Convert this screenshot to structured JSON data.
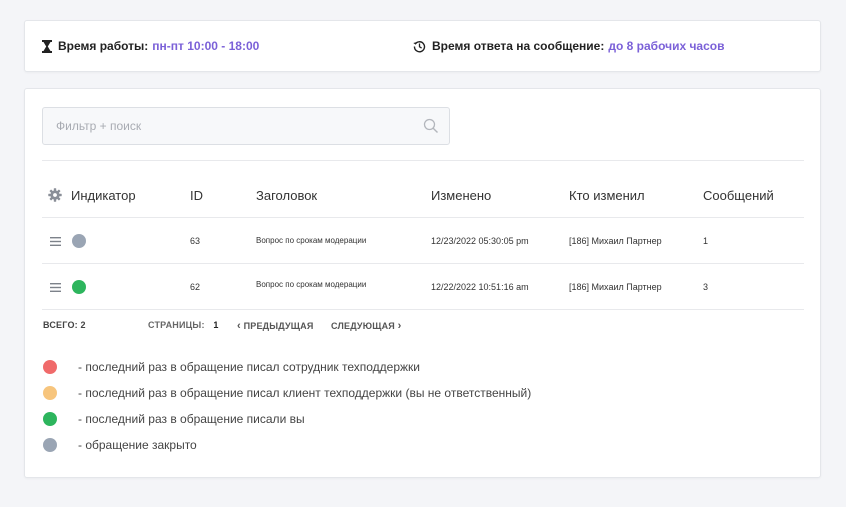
{
  "info": {
    "work_time_label": "Время работы:",
    "work_time_value": "пн-пт 10:00 - 18:00",
    "response_label": "Время ответа на сообщение:",
    "response_value": "до 8 рабочих часов"
  },
  "search": {
    "placeholder": "Фильтр + поиск"
  },
  "table": {
    "columns": [
      "Индикатор",
      "ID",
      "Заголовок",
      "Изменено",
      "Кто изменил",
      "Сообщений"
    ],
    "rows": [
      {
        "indicator_color": "#9aa5b4",
        "id": "63",
        "title": "Вопрос по срокам модерации",
        "changed": "12/23/2022 05:30:05 pm",
        "changed_by": "[186] Михаил Партнер",
        "messages": "1"
      },
      {
        "indicator_color": "#2db55d",
        "id": "62",
        "title": "Вопрос по срокам модерации",
        "changed": "12/22/2022 10:51:16 am",
        "changed_by": "[186] Михаил Партнер",
        "messages": "3"
      }
    ]
  },
  "pager": {
    "total_label": "ВСЕГО: 2",
    "pages_label": "СТРАНИЦЫ:",
    "pages_value": "1",
    "prev_label": "ПРЕДЫДУЩАЯ",
    "next_label": "СЛЕДУЮЩАЯ"
  },
  "legend": [
    {
      "color": "#f06a6a",
      "text": "- последний раз в обращение писал сотрудник техподдержки"
    },
    {
      "color": "#f7c57d",
      "text": "- последний раз в обращение писал клиент техподдержки (вы не ответственный)"
    },
    {
      "color": "#2db55d",
      "text": "- последний раз в обращение писали вы"
    },
    {
      "color": "#9aa5b4",
      "text": "- обращение закрыто"
    }
  ],
  "colors": {
    "accent": "#7b61d8"
  }
}
